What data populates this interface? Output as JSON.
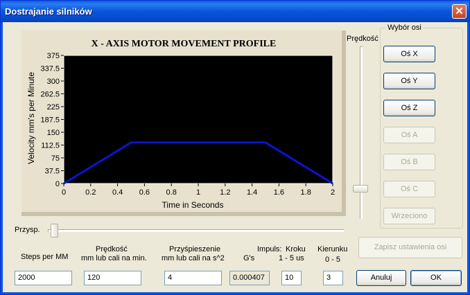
{
  "window": {
    "title": "Dostrajanie silników",
    "close_symbol": "✕"
  },
  "chart_data": {
    "type": "line",
    "title": "X - AXIS MOTOR MOVEMENT PROFILE",
    "xlabel": "Time in Seconds",
    "ylabel": "Velocity mm's per Minute",
    "xlim": [
      0,
      2
    ],
    "ylim": [
      0,
      375
    ],
    "x_ticks": [
      "0",
      "0.2",
      "0.4",
      "0.6",
      "0.8",
      "1",
      "1.2",
      "1.4",
      "1.6",
      "1.8",
      "2"
    ],
    "y_ticks": [
      "0",
      "37.5",
      "75",
      "112.5",
      "150",
      "187.5",
      "225",
      "262.5",
      "300",
      "337.5",
      "375"
    ],
    "series": [
      {
        "x": [
          0,
          0.5,
          1.5,
          2
        ],
        "y": [
          0,
          120,
          120,
          0
        ]
      }
    ],
    "line_color": "#0A14D0",
    "plot_background": "#000000"
  },
  "speed_slider": {
    "label": "Prędkość"
  },
  "axis_group": {
    "title": "Wybór osi",
    "buttons": [
      {
        "label": "Oś X",
        "enabled": true
      },
      {
        "label": "Oś Y",
        "enabled": true
      },
      {
        "label": "Oś Z",
        "enabled": true
      },
      {
        "label": "Oś A",
        "enabled": false
      },
      {
        "label": "Oś B",
        "enabled": false
      },
      {
        "label": "Oś C",
        "enabled": false
      },
      {
        "label": "Wrzeciono",
        "enabled": false
      }
    ]
  },
  "accel_slider": {
    "label": "Przysp."
  },
  "save_button": {
    "label": "Zapisz ustawienia osi"
  },
  "fields": {
    "steps": {
      "label": "Steps per MM",
      "value": "2000"
    },
    "speed": {
      "label1": "Prędkość",
      "label2": "mm lub cali na min.",
      "value": "120"
    },
    "accel": {
      "label1": "Przyśpieszenie",
      "label2": "mm lub cali na s^2",
      "value": "4"
    },
    "gs": {
      "label": "G's",
      "value": "0.000407"
    },
    "impuls": {
      "label1": "Impuls:",
      "label_kroku": "Kroku",
      "label_range": "1 - 5 us",
      "value": "10"
    },
    "kierunek": {
      "label1": "Kierunku",
      "label2": "0 - 5",
      "value": "3"
    }
  },
  "buttons": {
    "cancel": "Anuluj",
    "ok": "OK"
  }
}
